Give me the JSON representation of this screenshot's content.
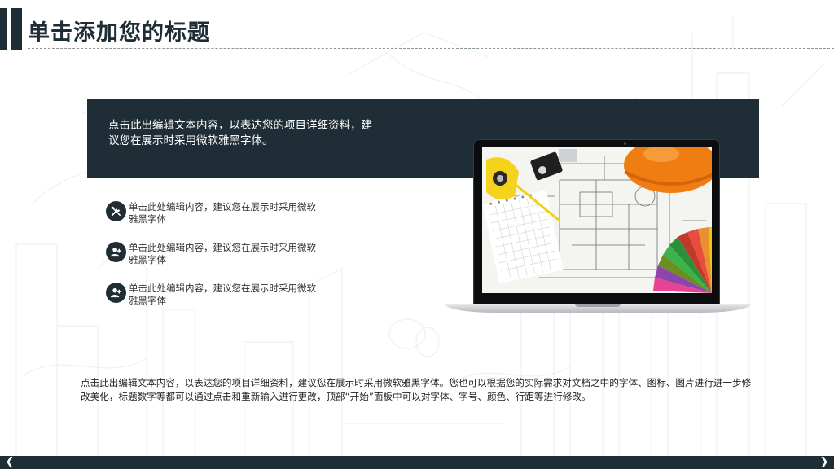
{
  "slide": {
    "title": "单击添加您的标题",
    "intro": "点击此出编辑文本内容，以表达您的项目详细资料，建议您在展示时采用微软雅黑字体。",
    "features": [
      {
        "icon": "tools-icon",
        "text": "单击此处编辑内容，建议您在展示时采用微软雅黑字体"
      },
      {
        "icon": "user-add-icon",
        "text": "单击此处编辑内容，建议您在展示时采用微软雅黑字体"
      },
      {
        "icon": "user-add-icon",
        "text": "单击此处编辑内容，建议您在展示时采用微软雅黑字体"
      }
    ],
    "body": "点击此出编辑文本内容，以表达您的项目详细资料，建议您在展示时采用微软雅黑字体。您也可以根据您的实际需求对文档之中的字体、图标、图片进行进一步修改美化，标题数字等都可以通过点击和重新输入进行更改，顶部“开始”面板中可以对字体、字号、颜色、行距等进行修改。"
  },
  "nav": {
    "prev": "❮",
    "next": "❯"
  },
  "colors": {
    "primary": "#1e2d36",
    "rule": "#8a949b",
    "helmet": "#f07d12",
    "tape": "#f5d21c"
  }
}
